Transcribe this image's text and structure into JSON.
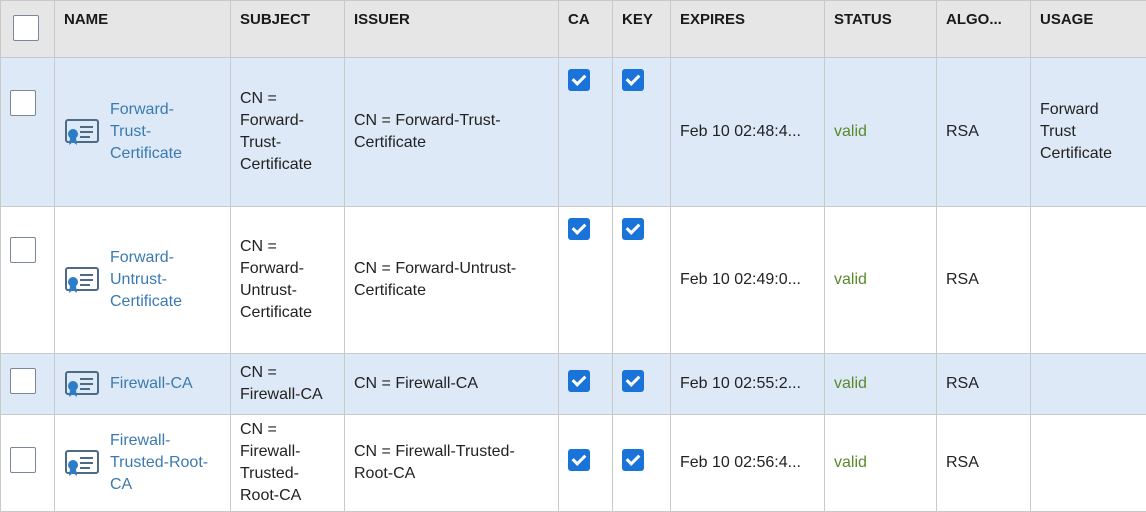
{
  "headers": {
    "name": "NAME",
    "subject": "SUBJECT",
    "issuer": "ISSUER",
    "ca": "CA",
    "key": "KEY",
    "expires": "EXPIRES",
    "status": "STATUS",
    "algorithm": "ALGO...",
    "usage": "USAGE"
  },
  "rows": [
    {
      "selected": false,
      "highlighted": true,
      "name_lines": [
        "Forward-",
        "Trust-",
        "Certificate"
      ],
      "subject_lines": [
        "CN =",
        "Forward-",
        "Trust-",
        "Certificate"
      ],
      "issuer_lines": [
        "CN = Forward-Trust-",
        "Certificate"
      ],
      "ca": true,
      "key": true,
      "expires": "Feb 10 02:48:4...",
      "status": "valid",
      "algorithm": "RSA",
      "usage_lines": [
        "Forward Trust",
        "Certificate"
      ]
    },
    {
      "selected": false,
      "highlighted": false,
      "name_lines": [
        "Forward-",
        "Untrust-",
        "Certificate"
      ],
      "subject_lines": [
        "CN =",
        "Forward-",
        "Untrust-",
        "Certificate"
      ],
      "issuer_lines": [
        "CN = Forward-Untrust-",
        "Certificate"
      ],
      "ca": true,
      "key": true,
      "expires": "Feb 10 02:49:0...",
      "status": "valid",
      "algorithm": "RSA",
      "usage_lines": []
    },
    {
      "selected": false,
      "highlighted": true,
      "name_lines": [
        "Firewall-CA"
      ],
      "subject_lines": [
        "CN =",
        "Firewall-CA"
      ],
      "issuer_lines": [
        "CN = Firewall-CA"
      ],
      "ca": true,
      "key": true,
      "expires": "Feb 10 02:55:2...",
      "status": "valid",
      "algorithm": "RSA",
      "usage_lines": []
    },
    {
      "selected": false,
      "highlighted": false,
      "name_lines": [
        "Firewall-",
        "Trusted-Root-",
        "CA"
      ],
      "subject_lines": [
        "CN =",
        "Firewall-",
        "Trusted-",
        "Root-CA"
      ],
      "issuer_lines": [
        "CN = Firewall-Trusted-",
        "Root-CA"
      ],
      "ca": true,
      "key": true,
      "expires": "Feb 10 02:56:4...",
      "status": "valid",
      "algorithm": "RSA",
      "usage_lines": []
    }
  ],
  "icons": {
    "header_checkbox": "checkbox-empty-icon",
    "row_checkbox": "checkbox-empty-icon",
    "certificate": "certificate-icon",
    "flag_checked": "checkbox-checked-icon"
  },
  "colors": {
    "header_bg": "#e6e6e6",
    "selected_row_bg": "#dde9f6",
    "link": "#3a7ab3",
    "valid": "#5a8a2c",
    "checkbox_fill": "#1a73d9",
    "border": "#c9c9c9"
  }
}
